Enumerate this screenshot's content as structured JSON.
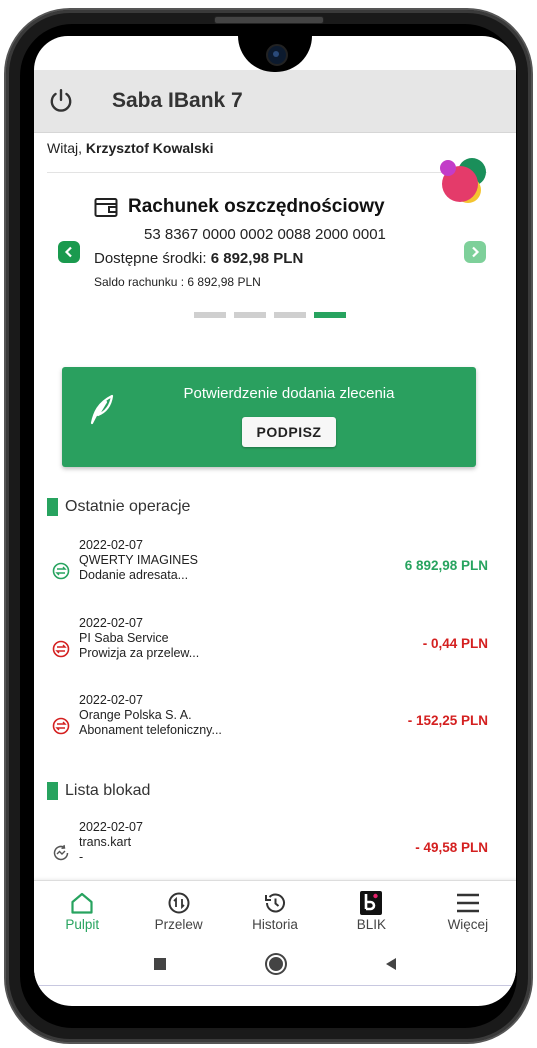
{
  "app": {
    "title": "Saba IBank 7"
  },
  "greeting": {
    "prefix": "Witaj, ",
    "name": "Krzysztof Kowalski"
  },
  "account": {
    "title": "Rachunek oszczędnościowy",
    "number": "53 8367 0000 0002 0088 2000 0001",
    "available_label": "Dostępne środki: ",
    "available_value": "6 892,98 PLN",
    "saldo": "Saldo rachunku : 6 892,98 PLN",
    "page_count": 4,
    "active_page": 4
  },
  "banner": {
    "text": "Potwierdzenie dodania zlecenia",
    "button": "PODPISZ"
  },
  "recent": {
    "title": "Ostatnie operacje",
    "items": [
      {
        "date": "2022-02-07",
        "name": "QWERTY IMAGINES",
        "desc": "Dodanie adresata...",
        "amount": "6 892,98 PLN",
        "type": "positive"
      },
      {
        "date": "2022-02-07",
        "name": "PI Saba Service",
        "desc": "Prowizja za przelew...",
        "amount": "- 0,44 PLN",
        "type": "negative"
      },
      {
        "date": "2022-02-07",
        "name": "Orange Polska S. A.",
        "desc": "Abonament telefoniczny...",
        "amount": "- 152,25 PLN",
        "type": "negative"
      }
    ]
  },
  "blocks": {
    "title": "Lista blokad",
    "items": [
      {
        "date": "2022-02-07",
        "name": "trans.kart",
        "desc": "-",
        "amount": "- 49,58 PLN",
        "type": "negative"
      }
    ]
  },
  "nav": {
    "items": [
      {
        "label": "Pulpit",
        "icon": "home-icon",
        "active": true
      },
      {
        "label": "Przelew",
        "icon": "transfer-icon",
        "active": false
      },
      {
        "label": "Historia",
        "icon": "history-icon",
        "active": false
      },
      {
        "label": "BLIK",
        "icon": "blik-icon",
        "active": false
      },
      {
        "label": "Więcej",
        "icon": "menu-icon",
        "active": false
      }
    ]
  },
  "colors": {
    "accent": "#27a35f",
    "negative": "#d42020",
    "header_bg": "#e6e6e6"
  }
}
